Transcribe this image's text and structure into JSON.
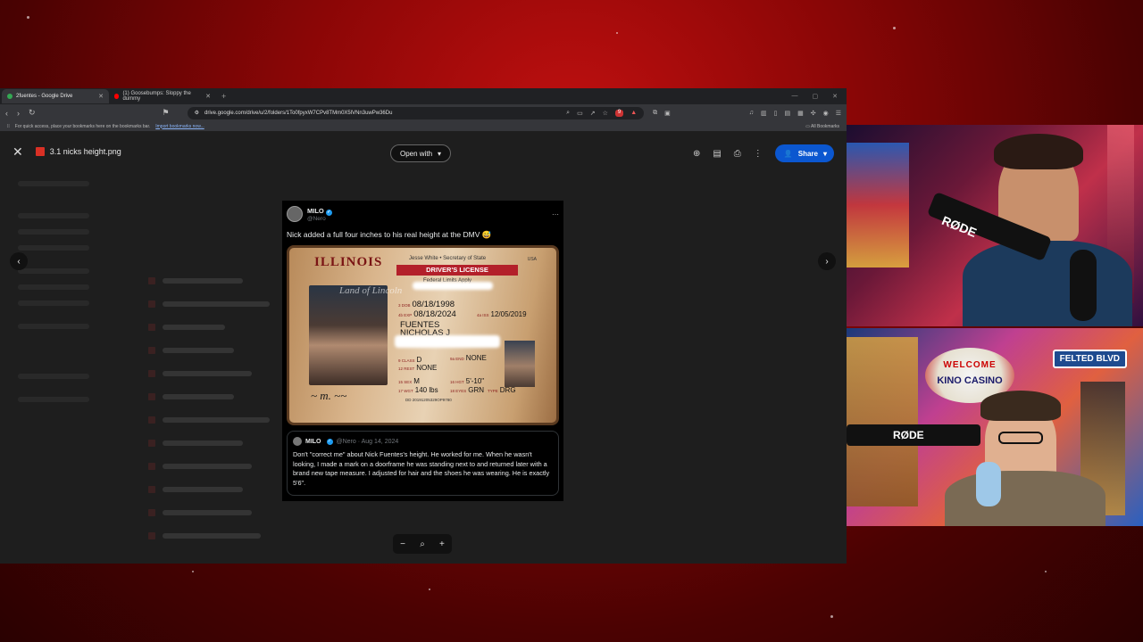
{
  "browser": {
    "tabs": [
      {
        "title": "2fuentes - Google Drive",
        "active": true,
        "favicon_color": "#34a853"
      },
      {
        "title": "(1) Goosebumps: Sloppy the dummy",
        "active": false,
        "favicon_color": "#ff0000"
      }
    ],
    "new_tab": "+",
    "url": "drive.google.com/drive/u/2/folders/1To0fpyxW7CPv8TMm0X5lVNn3uwPw36Du",
    "bookmarks_hint": "For quick access, place your bookmarks here on the bookmarks bar.",
    "bookmarks_link": "Import bookmarks now...",
    "all_bookmarks": "All Bookmarks",
    "extension_badge": "9"
  },
  "viewer": {
    "file_name": "3.1 nicks height.png",
    "open_with": "Open with",
    "share": "Share"
  },
  "tweet": {
    "name": "MILO",
    "handle": "@Nero",
    "text": "Nick added a full four inches to his real height at the DMV 😅",
    "license": {
      "state": "ILLINOIS",
      "secretary": "Jesse White • Secretary of State",
      "country": "USA",
      "title": "DRIVER'S LICENSE",
      "federal": "Federal Limits Apply",
      "motto": "Land of Lincoln",
      "dob": "08/18/1998",
      "exp": "08/18/2024",
      "iss": "12/05/2019",
      "last_name": "FUENTES",
      "first_name": "NICHOLAS J",
      "class": "D",
      "end": "NONE",
      "rest": "NONE",
      "sex": "M",
      "height": "5'-10\"",
      "weight": "140 lbs",
      "eyes": "GRN",
      "type": "DRG",
      "dd": "DD 20191205329OP9780",
      "labels": {
        "dob": "3 DOB",
        "exp": "4b EXP",
        "iss": "4a ISS",
        "class": "9 CLASS",
        "end": "9a END",
        "rest": "12 REST",
        "sex": "15 SEX",
        "hgt": "16 HGT",
        "wgt": "17 WGT",
        "eyes": "18 EYES",
        "type": "TYPE"
      }
    },
    "quote": {
      "name": "MILO",
      "meta": "@Nero · Aug 14, 2024",
      "text": "Don't \"correct me\" about Nick Fuentes's height. He worked for me. When he wasn't looking, I made a mark on a doorframe he was standing next to and returned later with a brand new tape measure. I adjusted for hair and the shoes he was wearing. He is exactly 5'6\"."
    }
  },
  "cams": {
    "top_mic": "RØDE",
    "bottom_mic": "RØDE",
    "sign_welcome": "WELCOME",
    "sign_casino": "KINO CASINO",
    "street_sign": "FELTED BLVD"
  }
}
